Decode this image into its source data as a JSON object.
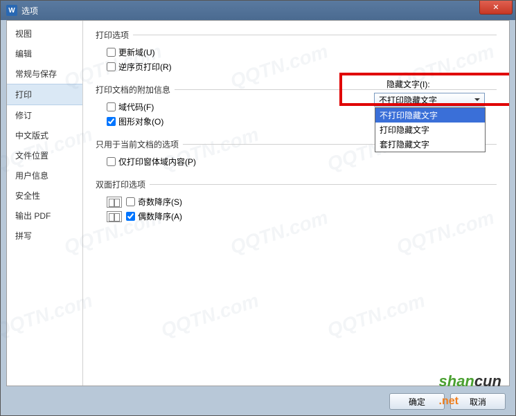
{
  "title": "选项",
  "titleIcon": "W",
  "sidebar": {
    "items": [
      {
        "label": "视图"
      },
      {
        "label": "编辑"
      },
      {
        "label": "常规与保存"
      },
      {
        "label": "打印"
      },
      {
        "label": "修订"
      },
      {
        "label": "中文版式"
      },
      {
        "label": "文件位置"
      },
      {
        "label": "用户信息"
      },
      {
        "label": "安全性"
      },
      {
        "label": "输出 PDF"
      },
      {
        "label": "拼写"
      }
    ],
    "selectedIndex": 3
  },
  "content": {
    "group1": {
      "title": "打印选项",
      "items": [
        {
          "label": "更新域(U)",
          "checked": false
        },
        {
          "label": "逆序页打印(R)",
          "checked": false
        }
      ]
    },
    "group2": {
      "title": "打印文档的附加信息",
      "items": [
        {
          "label": "域代码(F)",
          "checked": false
        },
        {
          "label": "图形对象(O)",
          "checked": true
        }
      ],
      "hiddenText": {
        "label": "隐藏文字(I):",
        "selected": "不打印隐藏文字",
        "options": [
          "不打印隐藏文字",
          "打印隐藏文字",
          "套打隐藏文字"
        ]
      }
    },
    "group3": {
      "title": "只用于当前文档的选项",
      "items": [
        {
          "label": "仅打印窗体域内容(P)",
          "checked": false
        }
      ]
    },
    "group4": {
      "title": "双面打印选项",
      "items": [
        {
          "label": "奇数降序(S)",
          "checked": false
        },
        {
          "label": "偶数降序(A)",
          "checked": true
        }
      ]
    }
  },
  "footer": {
    "ok": "确定",
    "cancel": "取消"
  },
  "watermark": {
    "bg": "QQTN.com",
    "shan": "shan",
    "cun": "cun",
    "net": ".net"
  }
}
